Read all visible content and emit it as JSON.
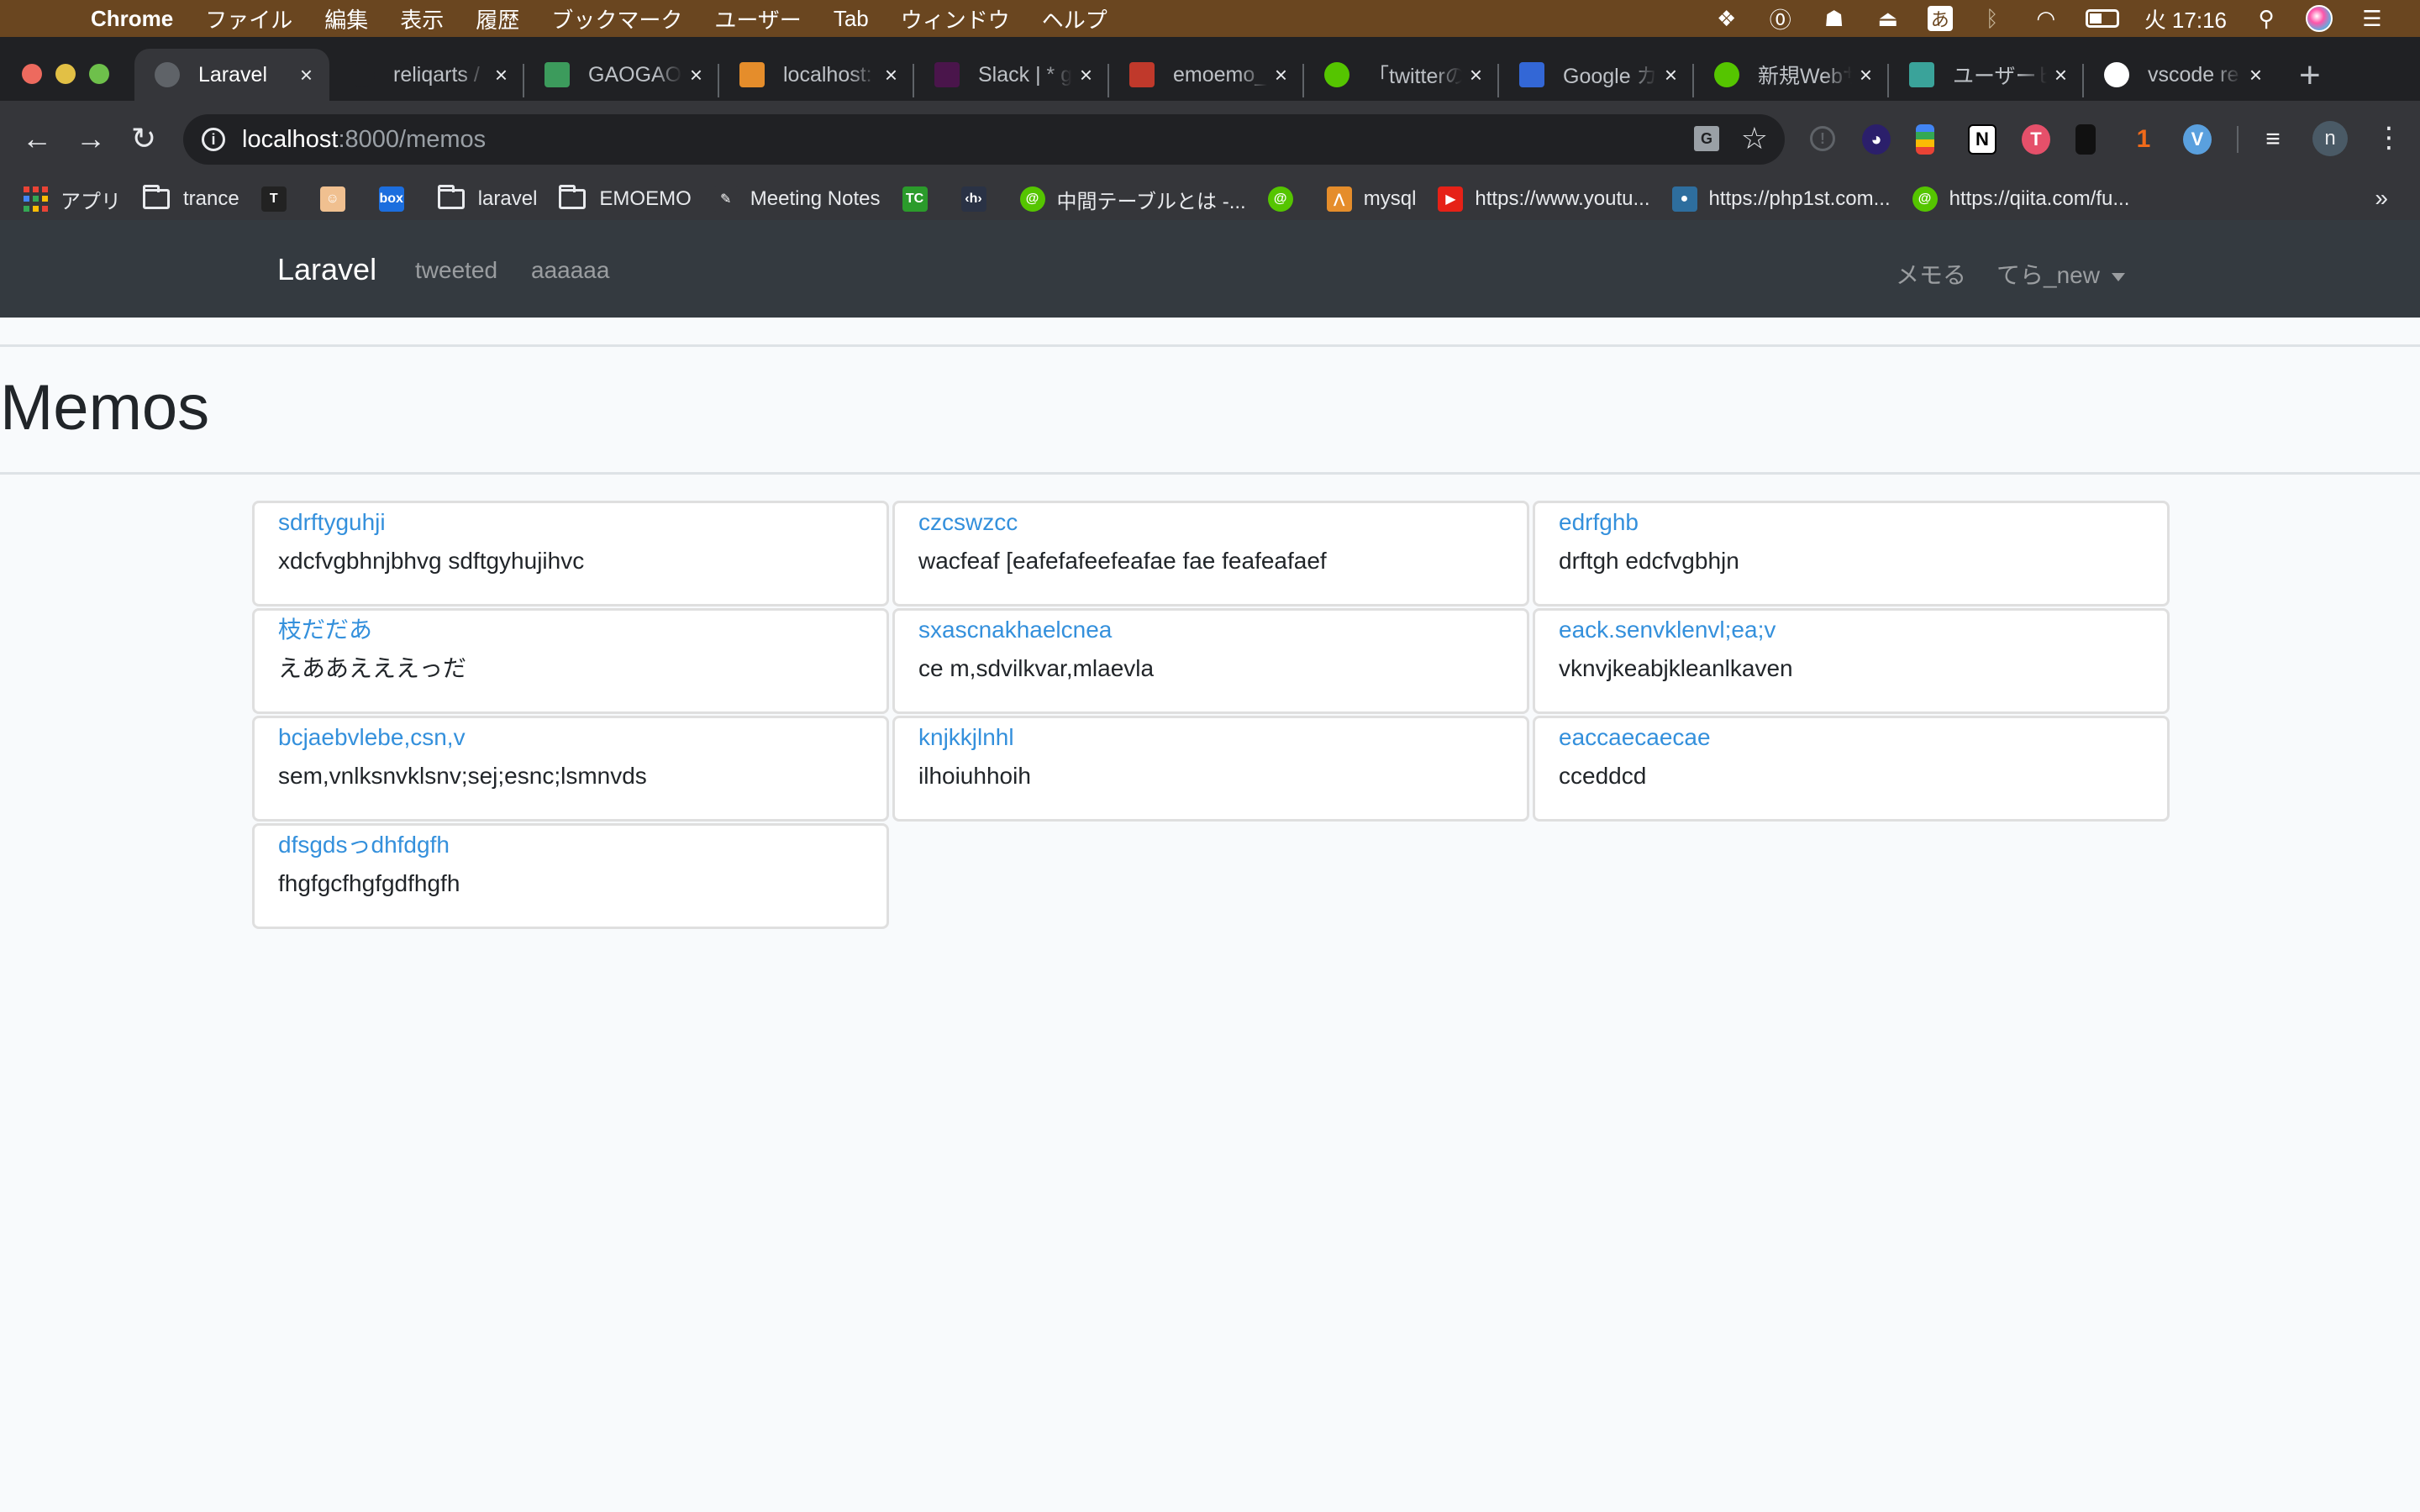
{
  "menubar": {
    "app_name": "Chrome",
    "items": [
      "ファイル",
      "編集",
      "表示",
      "履歴",
      "ブックマーク",
      "ユーザー",
      "Tab",
      "ウィンドウ",
      "ヘルプ"
    ],
    "status": {
      "ime": "あ",
      "clock": "火 17:16"
    }
  },
  "tabs": [
    {
      "label": "Laravel",
      "icon": "globe-icon",
      "active": true,
      "color": "#5f6368"
    },
    {
      "label": "reliqarts / ",
      "icon": "github-icon",
      "color": "#202124"
    },
    {
      "label": "GAOGAO",
      "icon": "sheets-icon",
      "color": "#3c9b5c"
    },
    {
      "label": "localhost:",
      "icon": "phpmyadmin-icon",
      "color": "#e58d2b"
    },
    {
      "label": "Slack | * g",
      "icon": "slack-icon",
      "color": "#4a154b"
    },
    {
      "label": "emoemo_",
      "icon": "backpack-icon",
      "color": "#c0392b"
    },
    {
      "label": "「twitterの",
      "icon": "qiita-icon",
      "color": "#55c500"
    },
    {
      "label": "Google カ",
      "icon": "calendar-icon",
      "color": "#3367d6"
    },
    {
      "label": "新規Webサ",
      "icon": "qiita-icon",
      "color": "#55c500"
    },
    {
      "label": "ユーザーヒ",
      "icon": "upload-icon",
      "color": "#3aa39a"
    },
    {
      "label": "vscode re",
      "icon": "google-icon",
      "color": "#ffffff"
    }
  ],
  "toolbar": {
    "url_host": "localhost",
    "url_rest": ":8000/memos",
    "profile_initial": "n"
  },
  "bookmarks": [
    {
      "label": "アプリ",
      "type": "apps"
    },
    {
      "label": "trance",
      "type": "folder"
    },
    {
      "label": "",
      "type": "icon",
      "icon": "typora-icon",
      "color": "#222222",
      "glyph": "T"
    },
    {
      "label": "",
      "type": "icon",
      "icon": "avatar-icon",
      "color": "#f0c090",
      "glyph": "☺"
    },
    {
      "label": "",
      "type": "icon",
      "icon": "box-icon",
      "color": "#1c6ede",
      "glyph": "box"
    },
    {
      "label": "laravel",
      "type": "folder"
    },
    {
      "label": "EMOEMO",
      "type": "folder"
    },
    {
      "label": "Meeting Notes",
      "type": "icon",
      "icon": "pencil-icon",
      "color": "#35363a",
      "glyph": "✎"
    },
    {
      "label": "",
      "type": "icon",
      "icon": "techcrunch-icon",
      "color": "#2b9b2b",
      "glyph": "TC"
    },
    {
      "label": "",
      "type": "icon",
      "icon": "hatena-icon",
      "color": "#2a3245",
      "glyph": "‹h›"
    },
    {
      "label": "中間テーブルとは -...",
      "type": "icon",
      "icon": "qiita-icon",
      "color": "#55c500",
      "glyph": "@"
    },
    {
      "label": "",
      "type": "icon",
      "icon": "qiita-icon",
      "color": "#55c500",
      "glyph": "@"
    },
    {
      "label": "mysql",
      "type": "icon",
      "icon": "phpmyadmin-icon",
      "color": "#e58d2b",
      "glyph": "⋀"
    },
    {
      "label": "https://www.youtu...",
      "type": "icon",
      "icon": "youtube-icon",
      "color": "#e62117",
      "glyph": "▶"
    },
    {
      "label": "https://php1st.com...",
      "type": "icon",
      "icon": "php1st-icon",
      "color": "#2e6e9e",
      "glyph": "●"
    },
    {
      "label": "https://qiita.com/fu...",
      "type": "icon",
      "icon": "qiita-icon",
      "color": "#55c500",
      "glyph": "@"
    }
  ],
  "bookmarks_overflow": "»",
  "app": {
    "brand": "Laravel",
    "nav_left": [
      "tweeted",
      "aaaaaa"
    ],
    "nav_right_link": "メモる",
    "user_dropdown": "てら_new",
    "page_title": "Memos",
    "accent_color": "#3490dc"
  },
  "memos": [
    {
      "title": "sdrftyguhji",
      "body": "xdcfvgbhnjbhvg sdftgyhujihvc"
    },
    {
      "title": "czcswzcc",
      "body": "wacfeaf [eafefafeefeafae fae feafeafaef"
    },
    {
      "title": "edrfghb",
      "body": "drftgh edcfvgbhjn"
    },
    {
      "title": "枝だだあ",
      "body": "えああえええっだ"
    },
    {
      "title": "sxascnakhaelcnea",
      "body": "ce m,sdvilkvar,mlaevla"
    },
    {
      "title": "eack.senvklenvl;ea;v",
      "body": "vknvjkeabjkleanlkaven"
    },
    {
      "title": "bcjaebvlebe,csn,v",
      "body": "sem,vnlksnvklsnv;sej;esnc;lsmnvds"
    },
    {
      "title": "knjkkjlnhl",
      "body": "ilhoiuhhoih"
    },
    {
      "title": "eaccaecaecae",
      "body": "cceddcd"
    },
    {
      "title": "dfsgdsっdhfdgfh",
      "body": "fhgfgcfhgfgdfhgfh"
    }
  ]
}
